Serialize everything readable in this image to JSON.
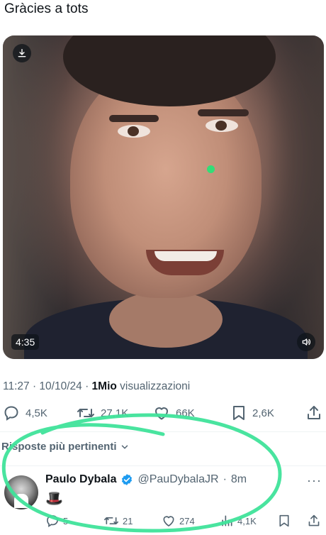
{
  "tweet": {
    "text": "Gràcies a tots",
    "video": {
      "duration": "4:35",
      "download_icon": "download-icon",
      "volume_icon": "volume-icon"
    },
    "meta": {
      "time": "11:27",
      "date": "10/10/24",
      "views_count": "1Mio",
      "views_label": "visualizzazioni"
    },
    "actions": {
      "replies": "4,5K",
      "retweets": "27,1K",
      "likes": "66K",
      "bookmarks": "2,6K"
    }
  },
  "replies_section": {
    "sort_label": "Risposte più pertinenti"
  },
  "reply": {
    "name": "Paulo Dybala",
    "handle": "@PauDybalaJR",
    "time": "8m",
    "more": "···",
    "text": "🎩",
    "actions": {
      "replies": "5",
      "retweets": "21",
      "likes": "274",
      "views": "4,1K"
    }
  },
  "colors": {
    "accent_green": "#3fe39a",
    "verified_blue": "#1d9bf0",
    "muted": "#536471",
    "text": "#0f1419"
  }
}
